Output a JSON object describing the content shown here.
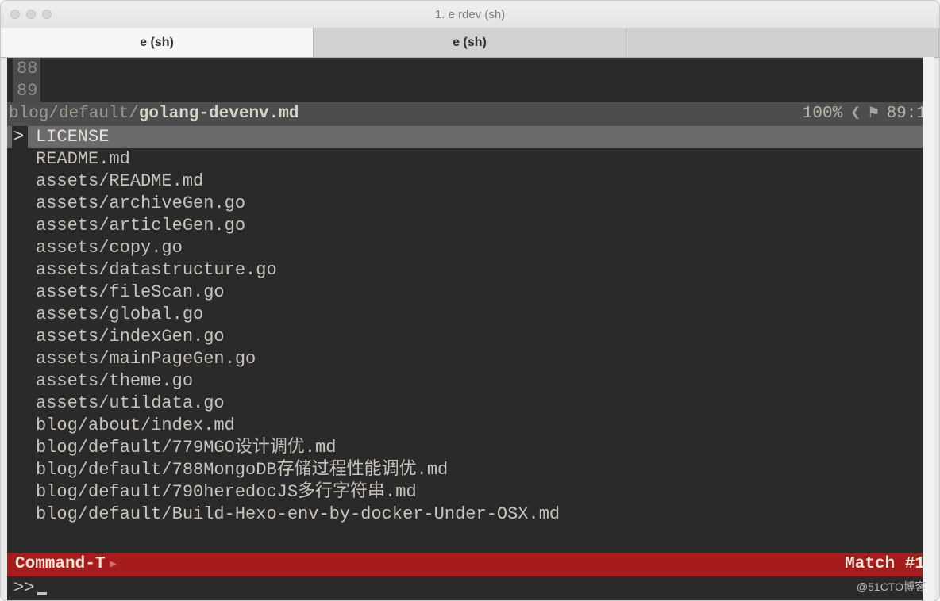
{
  "window": {
    "title": "1. e rdev (sh)"
  },
  "tabs": [
    {
      "label": "e (sh)",
      "active": true
    },
    {
      "label": "e (sh)",
      "active": false
    },
    {
      "label": "",
      "active": false
    }
  ],
  "gutter": {
    "lines": [
      "88",
      "89"
    ]
  },
  "status": {
    "path_prefix": "blog/default/",
    "path_file": "golang-devenv.md",
    "percent": "100%",
    "glyph_left": "❮",
    "glyph_flag": "⚑",
    "line": "89",
    "col": "1"
  },
  "files": [
    "LICENSE",
    "README.md",
    "assets/README.md",
    "assets/archiveGen.go",
    "assets/articleGen.go",
    "assets/copy.go",
    "assets/datastructure.go",
    "assets/fileScan.go",
    "assets/global.go",
    "assets/indexGen.go",
    "assets/mainPageGen.go",
    "assets/theme.go",
    "assets/utildata.go",
    "blog/about/index.md",
    "blog/default/779MGO设计调优.md",
    "blog/default/788MongoDB存储过程性能调优.md",
    "blog/default/790heredocJS多行字符串.md",
    "blog/default/Build-Hexo-env-by-docker-Under-OSX.md"
  ],
  "selected_index": 0,
  "command_t": {
    "label": "Command-T",
    "match": "Match #1"
  },
  "prompt": ">>",
  "watermark": "@51CTO博客"
}
